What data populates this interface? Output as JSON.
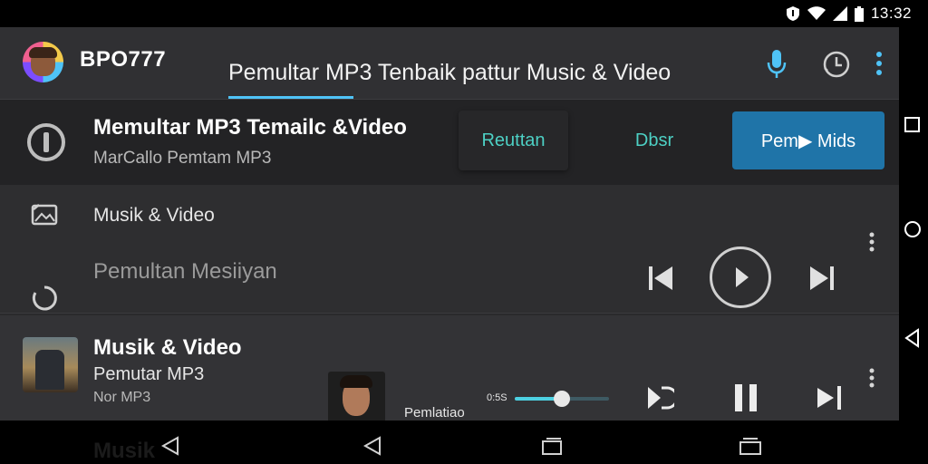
{
  "status": {
    "time": "13:32"
  },
  "header": {
    "brand": "BPO777",
    "tab_label": "Pemultar MP3 Tenbaik pattur Music & Video"
  },
  "card": {
    "title": "Memultar MP3 Temailc &Video",
    "subtitle": "MarCallo Pemtam MP3",
    "button_ghost": "Reuttan",
    "button_text": "Dbsr",
    "button_primary": "Pem▶ Mids"
  },
  "panel": {
    "row1_label": "Musik & Video",
    "row2_label": "Pemultan Mesiiyan"
  },
  "now_playing": {
    "title": "Musik & Video",
    "artist": "Pemutar MP3",
    "album": "Nor MP3",
    "caption": "Pemlatiao",
    "time": "0:5S",
    "progress": 0.5
  },
  "bottom": {
    "ghost_label": "Musik"
  },
  "colors": {
    "accent": "#4fc3f7",
    "teal": "#4dd0c4",
    "primary_button": "#1f74a8"
  },
  "icons": {
    "status": [
      "shield-icon",
      "wifi-icon",
      "signal-icon",
      "battery-icon"
    ],
    "header": [
      "mic-icon",
      "history-icon",
      "more-vert-icon"
    ],
    "navbar": [
      "overview-icon",
      "home-icon",
      "back-icon"
    ],
    "bottom": [
      "back-icon",
      "back-icon",
      "recents-icon",
      "multiwindow-icon"
    ]
  }
}
